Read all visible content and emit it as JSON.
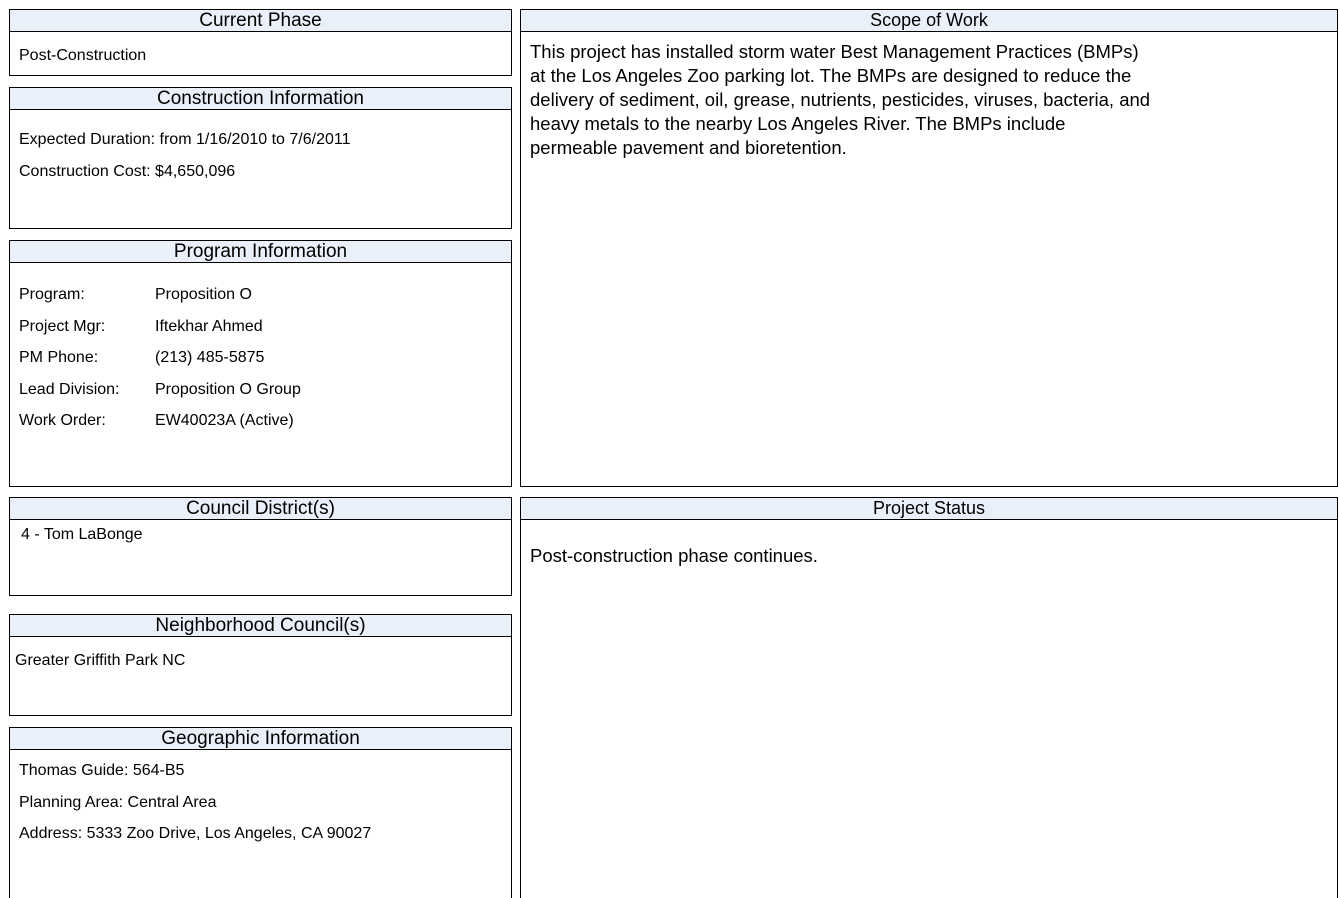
{
  "current_phase": {
    "title": "Current Phase",
    "value": "Post-Construction"
  },
  "construction_info": {
    "title": "Construction Information",
    "duration": "Expected Duration: from 1/16/2010 to 7/6/2011",
    "cost": "Construction Cost: $4,650,096"
  },
  "program_info": {
    "title": "Program Information",
    "rows": [
      {
        "label": "Program:",
        "value": "Proposition O"
      },
      {
        "label": "Project Mgr:",
        "value": "Iftekhar Ahmed"
      },
      {
        "label": "PM Phone:",
        "value": "(213) 485-5875"
      },
      {
        "label": "Lead Division:",
        "value": "Proposition O Group"
      },
      {
        "label": "Work Order:",
        "value": "EW40023A (Active)"
      }
    ]
  },
  "scope_of_work": {
    "title": "Scope of Work",
    "text": "This project has installed storm water Best Management Practices (BMPs)\nat the Los Angeles Zoo parking lot.  The BMPs are designed to reduce the\ndelivery of sediment, oil, grease, nutrients, pesticides, viruses, bacteria, and\nheavy metals to the nearby Los Angeles River.  The BMPs include\npermeable pavement and bioretention."
  },
  "council_districts": {
    "title": "Council District(s)",
    "value": "4 - Tom LaBonge"
  },
  "neighborhood_councils": {
    "title": "Neighborhood Council(s)",
    "value": "Greater Griffith Park NC"
  },
  "geographic_info": {
    "title": "Geographic Information",
    "thomas_guide": "Thomas Guide: 564-B5",
    "planning_area": "Planning Area:  Central Area",
    "address": "Address:  5333 Zoo Drive, Los Angeles, CA 90027"
  },
  "project_status": {
    "title": "Project Status",
    "text": "Post-construction phase continues."
  }
}
